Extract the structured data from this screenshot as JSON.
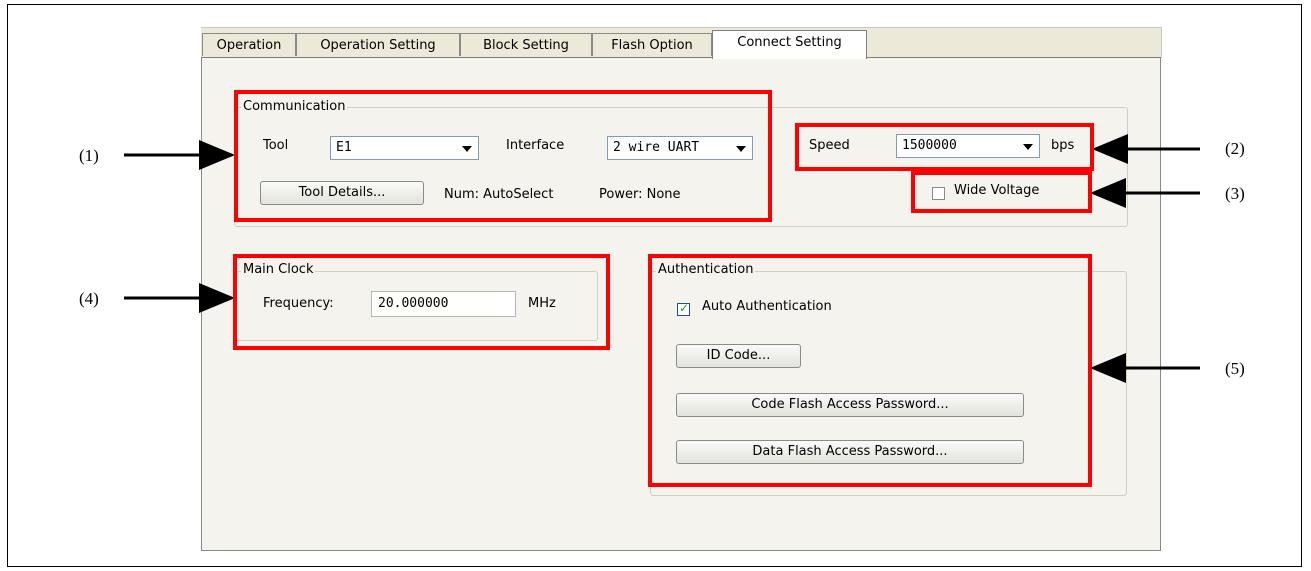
{
  "tabs": [
    "Operation",
    "Operation Setting",
    "Block Setting",
    "Flash Option",
    "Connect Setting"
  ],
  "active_tab": "Connect Setting",
  "communication": {
    "group_label": "Communication",
    "tool_label": "Tool",
    "tool_value": "E1",
    "interface_label": "Interface",
    "interface_value": "2 wire UART",
    "tool_details_button": "Tool Details...",
    "num_text": "Num: AutoSelect",
    "power_text": "Power: None"
  },
  "speed": {
    "label": "Speed",
    "value": "1500000",
    "unit": "bps"
  },
  "wide_voltage": {
    "label": "Wide Voltage",
    "checked": false
  },
  "main_clock": {
    "group_label": "Main Clock",
    "frequency_label": "Frequency:",
    "frequency_value": "20.000000",
    "unit": "MHz"
  },
  "authentication": {
    "group_label": "Authentication",
    "auto_auth_label": "Auto Authentication",
    "auto_auth_checked": true,
    "id_code_button": "ID Code...",
    "code_flash_button": "Code Flash Access Password...",
    "data_flash_button": "Data Flash Access Password..."
  },
  "callouts": [
    "(1)",
    "(2)",
    "(3)",
    "(4)",
    "(5)"
  ],
  "colors": {
    "highlight": "#ff0000",
    "dialog_bg": "#f4f3ee",
    "checkbox_tick": "#21a121"
  }
}
